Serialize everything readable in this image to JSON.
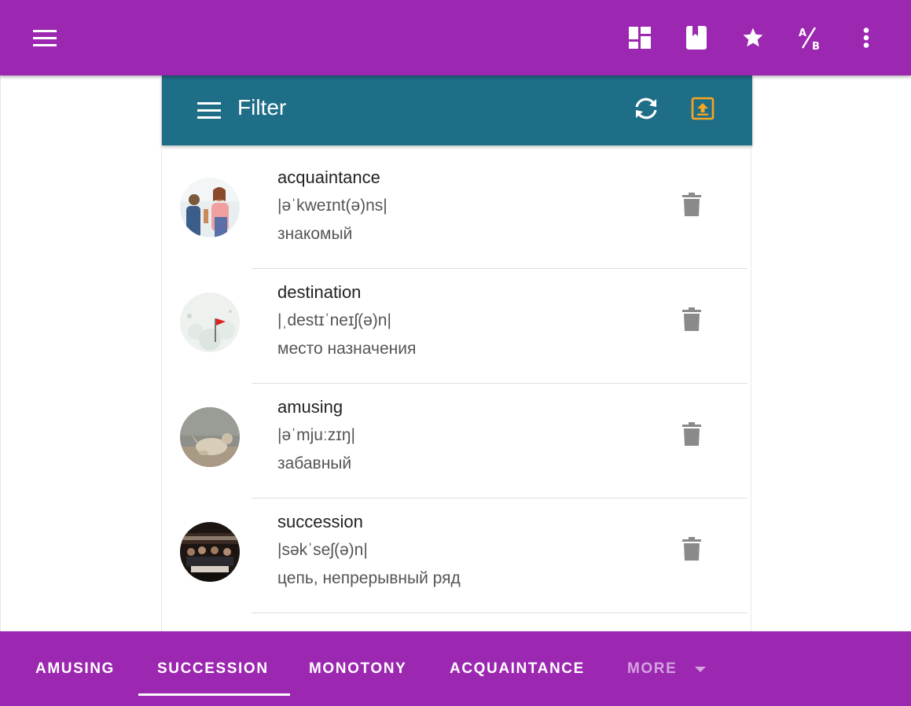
{
  "colors": {
    "appbar": "#9c27b0",
    "filterbar": "#1f6e87",
    "upload_accent": "#f5a623",
    "delete_icon": "#8a8a8a"
  },
  "appbar": {
    "icons": [
      "menu-icon",
      "dashboard-icon",
      "bookmark-icon",
      "star-icon",
      "ab-test-icon",
      "more-vert-icon"
    ],
    "ab_label": "A/B"
  },
  "filter": {
    "title": "Filter",
    "icons": [
      "menu-icon",
      "sync-icon",
      "upload-icon"
    ]
  },
  "words": [
    {
      "word": "acquaintance",
      "transcription": "|əˈkweɪnt(ə)ns|",
      "meaning": "знакомый",
      "image": "two people greeting"
    },
    {
      "word": "destination",
      "transcription": "|ˌdestɪˈneɪʃ(ə)n|",
      "meaning": "место назначения",
      "image": "red flag on snow"
    },
    {
      "word": "amusing",
      "transcription": "|əˈmjuːzɪŋ|",
      "meaning": "забавный",
      "image": "puppy on beach"
    },
    {
      "word": "succession",
      "transcription": "|səkˈseʃ(ə)n|",
      "meaning": "цепь, непрерывный ряд",
      "image": "Succession poster"
    }
  ],
  "tabs": [
    {
      "label": "AMUSING",
      "selected": false
    },
    {
      "label": "SUCCESSION",
      "selected": true
    },
    {
      "label": "MONOTONY",
      "selected": false
    },
    {
      "label": "ACQUAINTANCE",
      "selected": false
    },
    {
      "label": "MORE",
      "selected": false
    }
  ]
}
